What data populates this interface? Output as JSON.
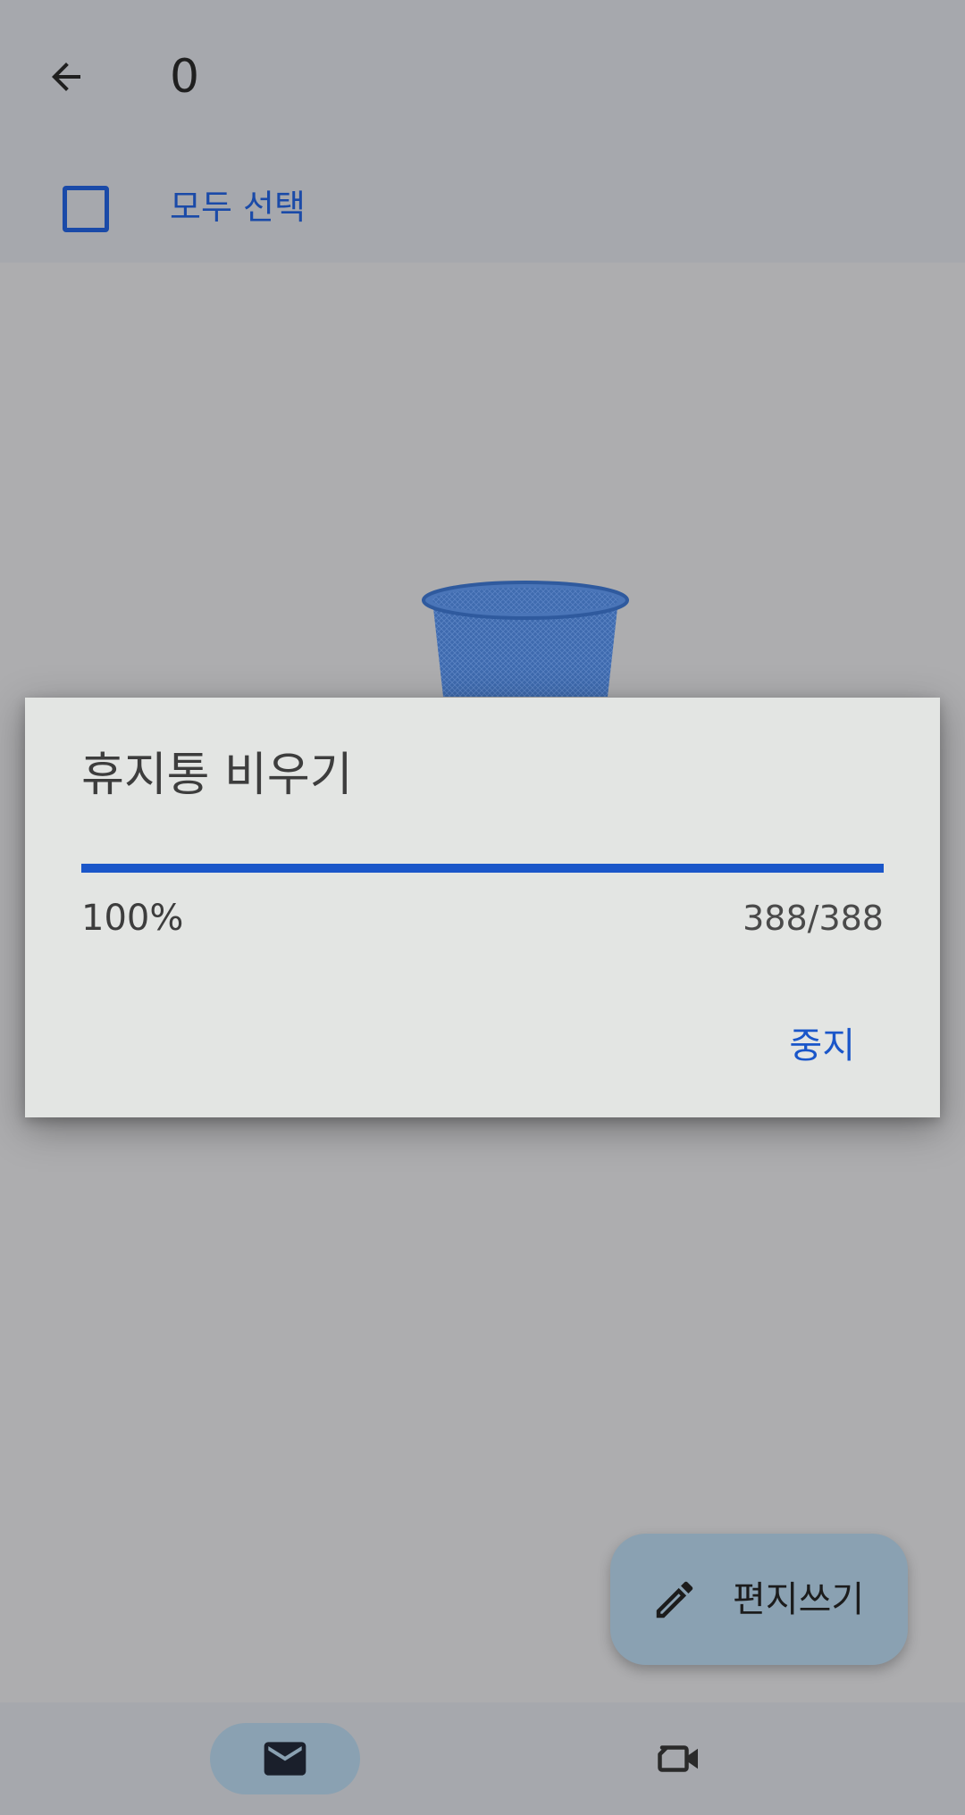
{
  "app_bar": {
    "back_icon": "arrow-left-icon",
    "selected_count": "0"
  },
  "select_all": {
    "label": "모두 선택",
    "checked": false
  },
  "dialog": {
    "title": "휴지통 비우기",
    "progress_percent_label": "100%",
    "progress_fraction": 1.0,
    "progress_count": "388/388",
    "stop_label": "중지",
    "accent_color": "#1a56c9"
  },
  "fab": {
    "icon": "pencil-icon",
    "label": "편지쓰기"
  },
  "bottom_nav": {
    "items": [
      {
        "name": "mail",
        "icon": "mail-icon",
        "active": true
      },
      {
        "name": "meet",
        "icon": "video-camera-icon",
        "active": false
      }
    ]
  },
  "illustration": "trash-bin-illustration"
}
